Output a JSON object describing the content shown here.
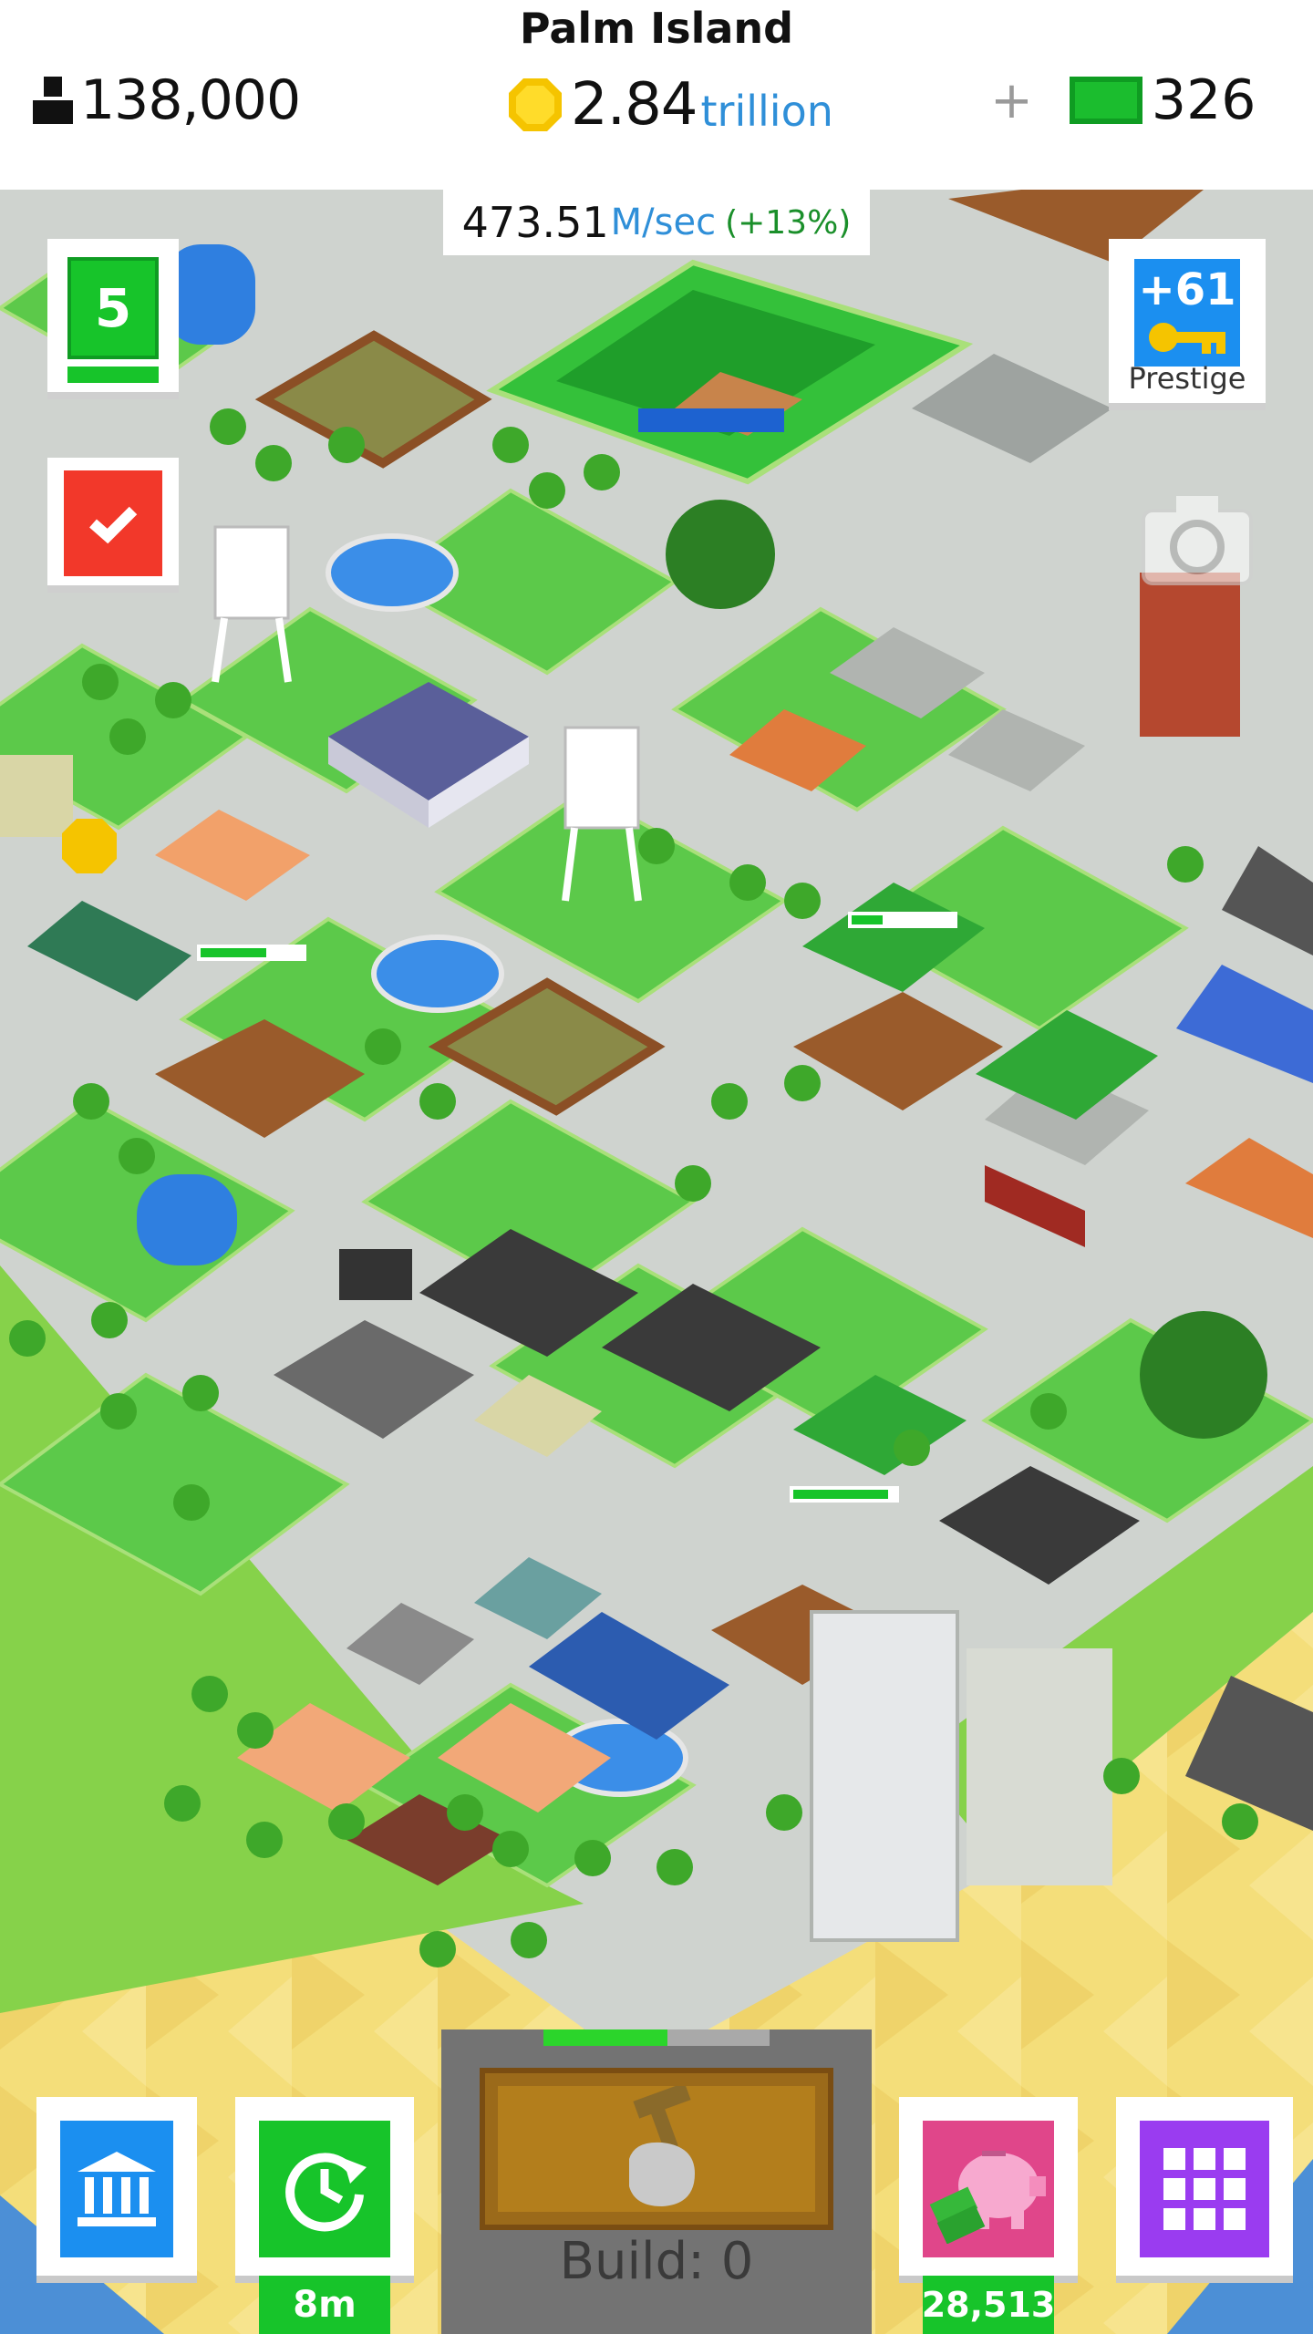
{
  "header": {
    "island_name": "Palm Island",
    "population": "138,000",
    "money_value": "2.84",
    "money_unit": "trillion",
    "cash_plus": "+",
    "cash_value": "326"
  },
  "income": {
    "value": "473.51",
    "unit": "M/sec",
    "bonus": "(+13%)"
  },
  "widgets": {
    "level": "5",
    "prestige_keys": "+61",
    "prestige_label": "Prestige"
  },
  "bottom": {
    "time_badge": "8m",
    "piggy_bank_value": "28,513",
    "build_label": "Build: 0",
    "build_progress": 0.55
  },
  "colors": {
    "grass": "#5cc94a",
    "road": "#cfd3cf",
    "accent_blue": "#1b8ff0",
    "accent_green": "#17c42a",
    "accent_red": "#f2382a",
    "accent_purple": "#9a3cf0"
  }
}
